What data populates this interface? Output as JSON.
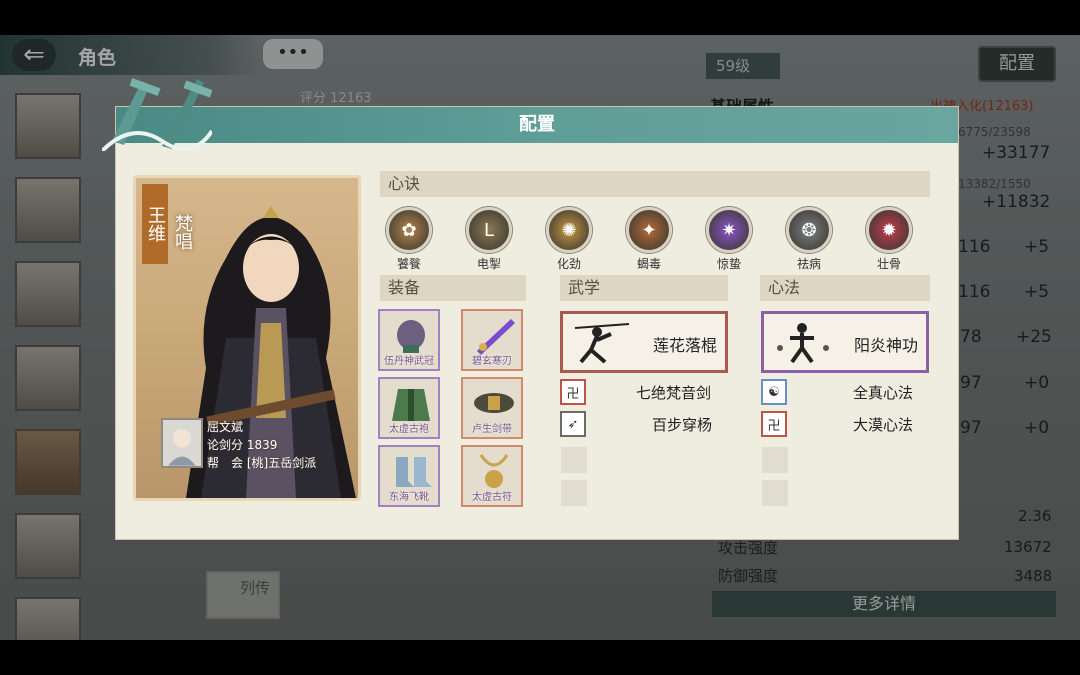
{
  "header": {
    "back_icon": "arrow-left-icon",
    "title": "角色",
    "chat_bubble": "•••"
  },
  "background": {
    "score_label": "评分",
    "score_value": "12163",
    "level": "59级",
    "config_button": "配置",
    "section_title": "基础属性",
    "section_right": "出神入化(12163)",
    "hp": "6775/23598",
    "hp_bonus": "+33177",
    "mp": "13382/1550",
    "mp_bonus": "+11832",
    "rows": [
      {
        "value": "116",
        "bonus": "+5"
      },
      {
        "value": "116",
        "bonus": "+5"
      },
      {
        "value": "78",
        "bonus": "+25"
      },
      {
        "value": "97",
        "bonus": "+0"
      },
      {
        "value": "97",
        "bonus": "+0"
      }
    ],
    "crit_value": "2.36",
    "attack_label": "攻击强度",
    "attack_value": "13672",
    "defense_label": "防御强度",
    "defense_value": "3488",
    "more_details": "更多详情",
    "liezhuan": "列传"
  },
  "modal": {
    "title": "配置",
    "character": {
      "name": "王维",
      "title": "梵唱",
      "owner_name": "屈文斌",
      "rank_label": "论剑分",
      "rank_value": "1839",
      "guild_label": "帮　会",
      "guild_value": "[桃]五岳剑派"
    },
    "xinjue_header": "心诀",
    "xinjue": [
      {
        "label": "饕餮",
        "color": "#b5864a",
        "glyph": "✿"
      },
      {
        "label": "电掣",
        "color": "#8c7a52",
        "glyph": "L"
      },
      {
        "label": "化劲",
        "color": "#c7973f",
        "glyph": "✺"
      },
      {
        "label": "蝎毒",
        "color": "#b56a37",
        "glyph": "✦"
      },
      {
        "label": "惊蛰",
        "color": "#8a54c9",
        "glyph": "✷"
      },
      {
        "label": "祛病",
        "color": "#7c7f82",
        "glyph": "❂"
      },
      {
        "label": "壮骨",
        "color": "#c23a4c",
        "glyph": "✹"
      }
    ],
    "equip_header": "装备",
    "equipment": [
      {
        "label": "伍丹神武冠"
      },
      {
        "label": "碧玄寒刃"
      },
      {
        "label": "太虚古袍"
      },
      {
        "label": "卢生剑带"
      },
      {
        "label": "东海飞靴"
      },
      {
        "label": "太虚古符"
      }
    ],
    "wuxue_header": "武学",
    "wuxue_main": "莲花落棍",
    "wuxue_list": [
      "七绝梵音剑",
      "百步穿杨"
    ],
    "xinfa_header": "心法",
    "xinfa_main": "阳炎神功",
    "xinfa_list": [
      "全真心法",
      "大漠心法"
    ]
  }
}
